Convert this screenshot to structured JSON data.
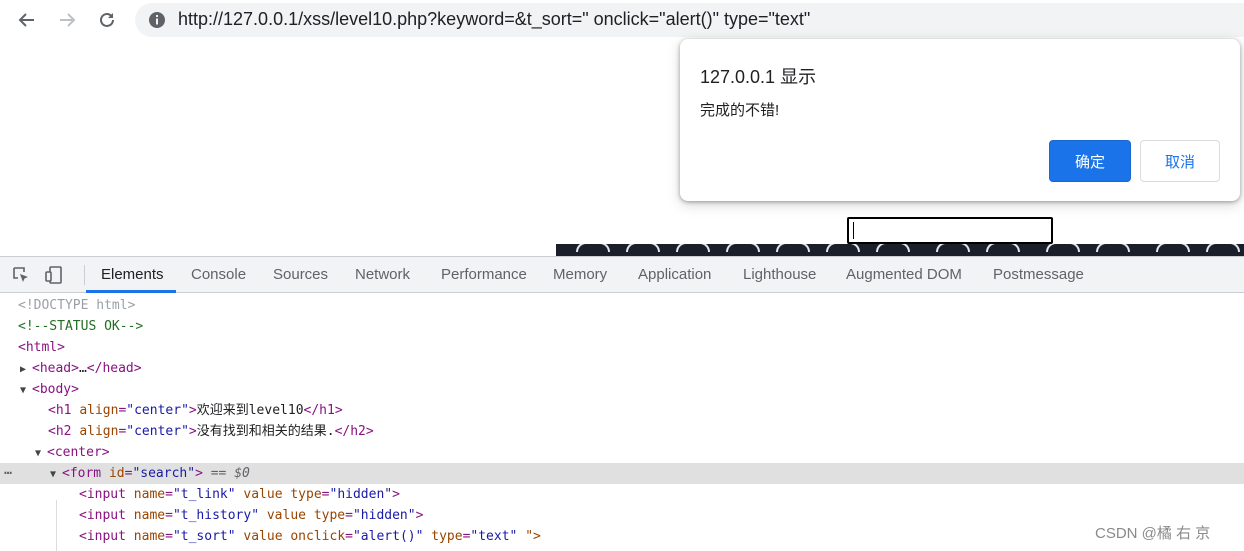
{
  "browser": {
    "url": "http://127.0.0.1/xss/level10.php?keyword=&t_sort=\" onclick=\"alert()\" type=\"text\""
  },
  "dialog": {
    "title": "127.0.0.1 显示",
    "message": "完成的不错!",
    "ok_label": "确定",
    "cancel_label": "取消"
  },
  "devtools": {
    "tabs": [
      "Elements",
      "Console",
      "Sources",
      "Network",
      "Performance",
      "Memory",
      "Application",
      "Lighthouse",
      "Augmented DOM",
      "Postmessage"
    ],
    "active_tab": "Elements",
    "dom": {
      "doctype": "<!DOCTYPE html>",
      "comment": "<!--STATUS OK-->",
      "html_open": "<html>",
      "head_open": "<head>",
      "head_ellipsis": "…",
      "head_close": "</head>",
      "body_open": "<body>",
      "h1_open": "<h1",
      "h1_attr": "align",
      "h1_val": "\"center\"",
      "h1_text": "欢迎来到level10",
      "h1_close": "</h1>",
      "h2_open": "<h2",
      "h2_attr": "align",
      "h2_val": "\"center\"",
      "h2_text": "没有找到和相关的结果.",
      "h2_close": "</h2>",
      "center_open": "<center>",
      "form_open": "<form",
      "form_attr": "id",
      "form_val": "\"search\"",
      "selected_marker": "== $0",
      "input1": {
        "name_val": "\"t_link\"",
        "type_val": "\"hidden\""
      },
      "input2": {
        "name_val": "\"t_history\"",
        "type_val": "\"hidden\""
      },
      "input3": {
        "name_val": "\"t_sort\"",
        "onclick_val": "\"alert()\"",
        "type_val": "\"text\"",
        "trail": "\">"
      }
    }
  },
  "watermark": "CSDN @橘 右 京",
  "colors": {
    "accent": "#1a73e8",
    "tag": "#881280",
    "attr": "#994500",
    "value": "#1a1aa6",
    "comment": "#236e25"
  }
}
